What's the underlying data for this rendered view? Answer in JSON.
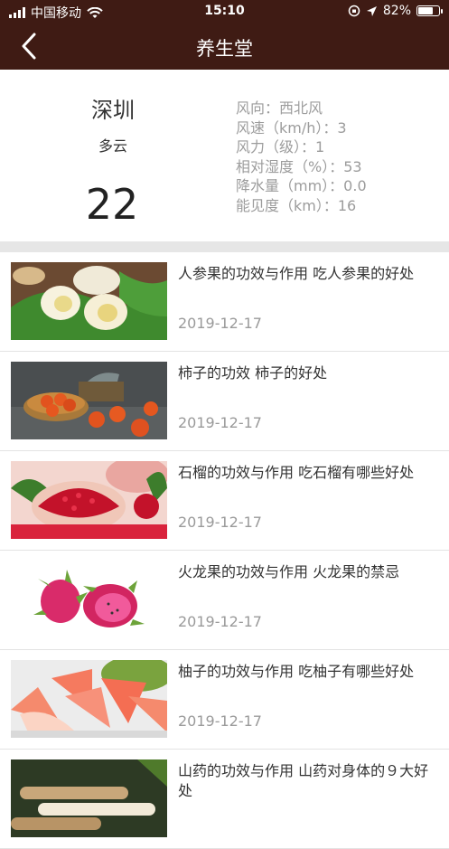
{
  "status_bar": {
    "carrier": "中国移动",
    "time": "15:10",
    "battery": "82%",
    "battery_level": 0.82
  },
  "header": {
    "title": "养生堂",
    "back_icon": "chevron-left-icon"
  },
  "weather": {
    "city": "深圳",
    "condition": "多云",
    "temperature": "22",
    "details": [
      "风向：西北风",
      "风速（km/h）：3",
      "风力（级）：1",
      "相对湿度（%）：53",
      "降水量（mm）：0.0",
      "能见度（km）：16"
    ]
  },
  "articles": [
    {
      "title": "人参果的功效与作用 吃人参果的好处",
      "date": "2019-12-17"
    },
    {
      "title": "柿子的功效 柿子的好处",
      "date": "2019-12-17"
    },
    {
      "title": "石榴的功效与作用 吃石榴有哪些好处",
      "date": "2019-12-17"
    },
    {
      "title": "火龙果的功效与作用 火龙果的禁忌",
      "date": "2019-12-17"
    },
    {
      "title": "柚子的功效与作用 吃柚子有哪些好处",
      "date": "2019-12-17"
    },
    {
      "title": "山药的功效与作用 山药对身体的９大好处",
      "date": ""
    }
  ],
  "colors": {
    "header_bg": "#3f1b14",
    "separator": "#e6e6e6",
    "detail_text": "#9c9c9c"
  }
}
